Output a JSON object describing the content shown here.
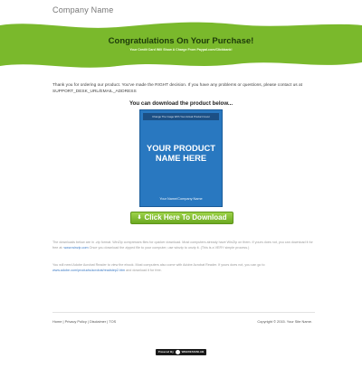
{
  "header": {
    "company_name": "Company Name"
  },
  "hero": {
    "title": "Congratulations On Your Purchase!",
    "subtitle": "Your Credit Card Will Show A Charge From Paypal.com/Clickbank!",
    "color": "#7ab92c"
  },
  "intro_text": "Thank you for ordering our product. You've made the RIGHT decision. If you have any problems or questions, please contact us at SUPPORT_DESK_URL/EMAIL_ADDRESS",
  "download": {
    "heading": "You can download the product below...",
    "product_top_text": "Change The Image With Your Actual Product Cover",
    "product_name_line1": "YOUR PRODUCT",
    "product_name_line2": "NAME HERE",
    "product_author": "Your Name/Company Name",
    "button_label": "Click Here To Download",
    "button_icon": "download-icon"
  },
  "fine_print": {
    "p1_before": "The downloads below are in .zip format. WinZip compresses files for quicker download. Most computers already have WinZip on them. If yours does not, you can download it for free at: ",
    "p1_link": "www.winzip.com",
    "p1_after": " Once you download the zipped file to your computer, use winzip to unzip it. (This is a VERY simple process.)",
    "p2_before": "You will need Adobe Acrobat Reader to view the ebook. Most computers also come with Adobe Acrobat Reader. If yours does not, you can go to ",
    "p2_link": "www.adobe.com/products/acrobat/readstep2.htm",
    "p2_after": " and download it for free."
  },
  "footer": {
    "links": [
      "Home",
      "Privacy Policy",
      "Disclaimer",
      "TOS"
    ],
    "separator": " | ",
    "copyright": "Copyright © 2015. Your Site Name."
  },
  "powered_by": {
    "label": "Powered By",
    "brand": "WEBDESIGNLAB"
  }
}
